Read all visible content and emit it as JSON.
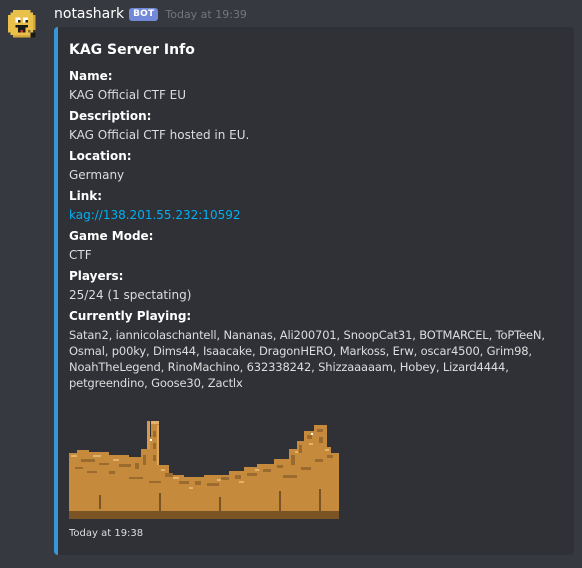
{
  "message": {
    "username": "notashark",
    "bot_tag": "BOT",
    "timestamp": "Today at 19:39",
    "avatar_icon": "pixel-face-avatar"
  },
  "embed": {
    "accent_color": "#3498db",
    "title": "KAG Server Info",
    "fields": [
      {
        "name": "Name:",
        "value": "KAG Official CTF EU"
      },
      {
        "name": "Description:",
        "value": "KAG Official CTF hosted in EU."
      },
      {
        "name": "Location:",
        "value": "Germany"
      },
      {
        "name": "Link:",
        "value": "kag://138.201.55.232:10592"
      },
      {
        "name": "Game Mode:",
        "value": "CTF"
      },
      {
        "name": "Players:",
        "value": "25/24 (1 spectating)"
      },
      {
        "name": "Currently Playing:",
        "value": "Satan2, iannicolaschantell, Nananas, Ali200701, SnoopCat31, BOTMARCEL, ToPTeeN, Osmal, p00ky, Dims44, Isaacake, DragonHERO, Markoss, Erw, oscar4500, Grim98, NoahTheLegend, RinoMachino, 632338242, Shizzaaaaam, Hobey, Lizard4444, petgreendino, Goose30, Zactlx"
      }
    ],
    "image": "map-minimap",
    "footer": "Today at 19:38"
  },
  "colors": {
    "background": "#36393f",
    "embed_background": "#2f3136",
    "link": "#00b0f4",
    "bot_tag": "#7289da",
    "map_ground": "#c68a3d"
  }
}
